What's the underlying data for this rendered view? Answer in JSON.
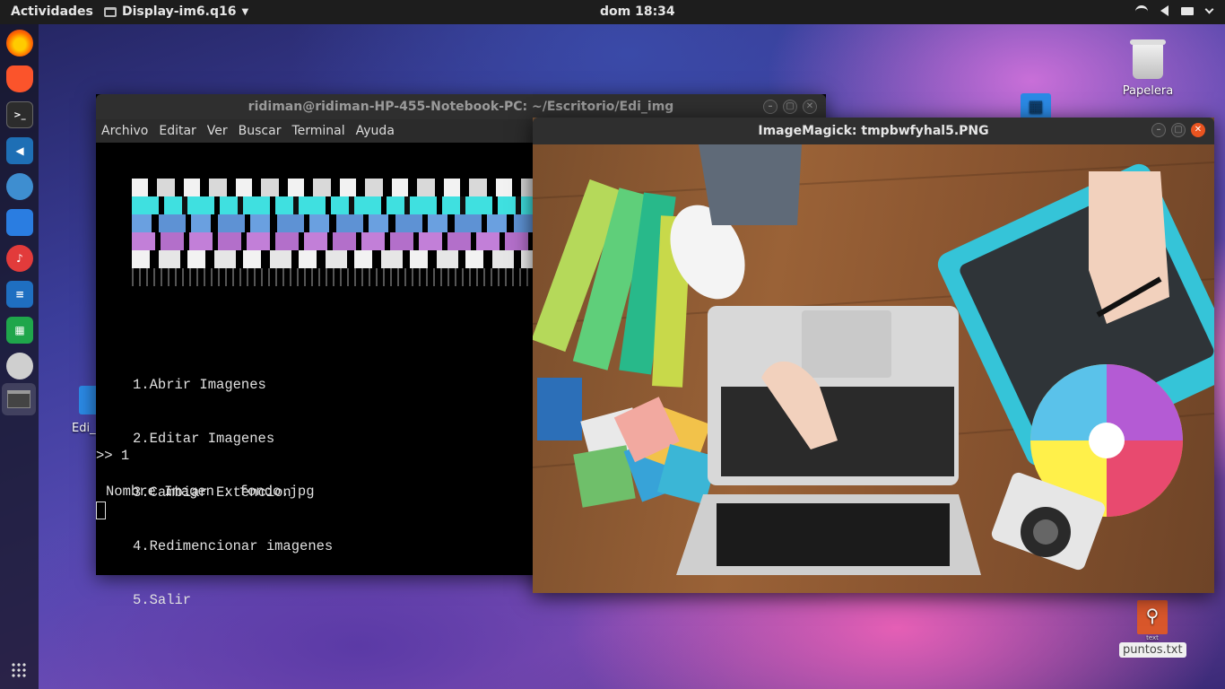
{
  "topbar": {
    "activities": "Actividades",
    "app_name": "Display-im6.q16",
    "clock": "dom 18:34"
  },
  "desktop": {
    "trash_label": "Papelera",
    "partial_icon_label": "Edi_",
    "file_label": "puntos.txt",
    "file_badge": "text"
  },
  "terminal": {
    "title": "ridiman@ridiman-HP-455-Notebook-PC: ~/Escritorio/Edi_img",
    "menu": [
      "Archivo",
      "Editar",
      "Ver",
      "Buscar",
      "Terminal",
      "Ayuda"
    ],
    "options": [
      "1.Abrir Imagenes",
      "2.Editar Imagenes",
      "3.Cambiar Extencion",
      "4.Redimencionar imagenes",
      "5.Salir"
    ],
    "prompt": ">> 1",
    "nombre_line": "Nombre Imagen : fondo.jpg"
  },
  "imagemagick": {
    "title": "ImageMagick: tmpbwfyhal5.PNG"
  },
  "colors": {
    "accent": "#e95420",
    "banner_cyan": "#3fe0e0",
    "banner_blue": "#6aa0e0",
    "banner_pink": "#c27fd8"
  }
}
